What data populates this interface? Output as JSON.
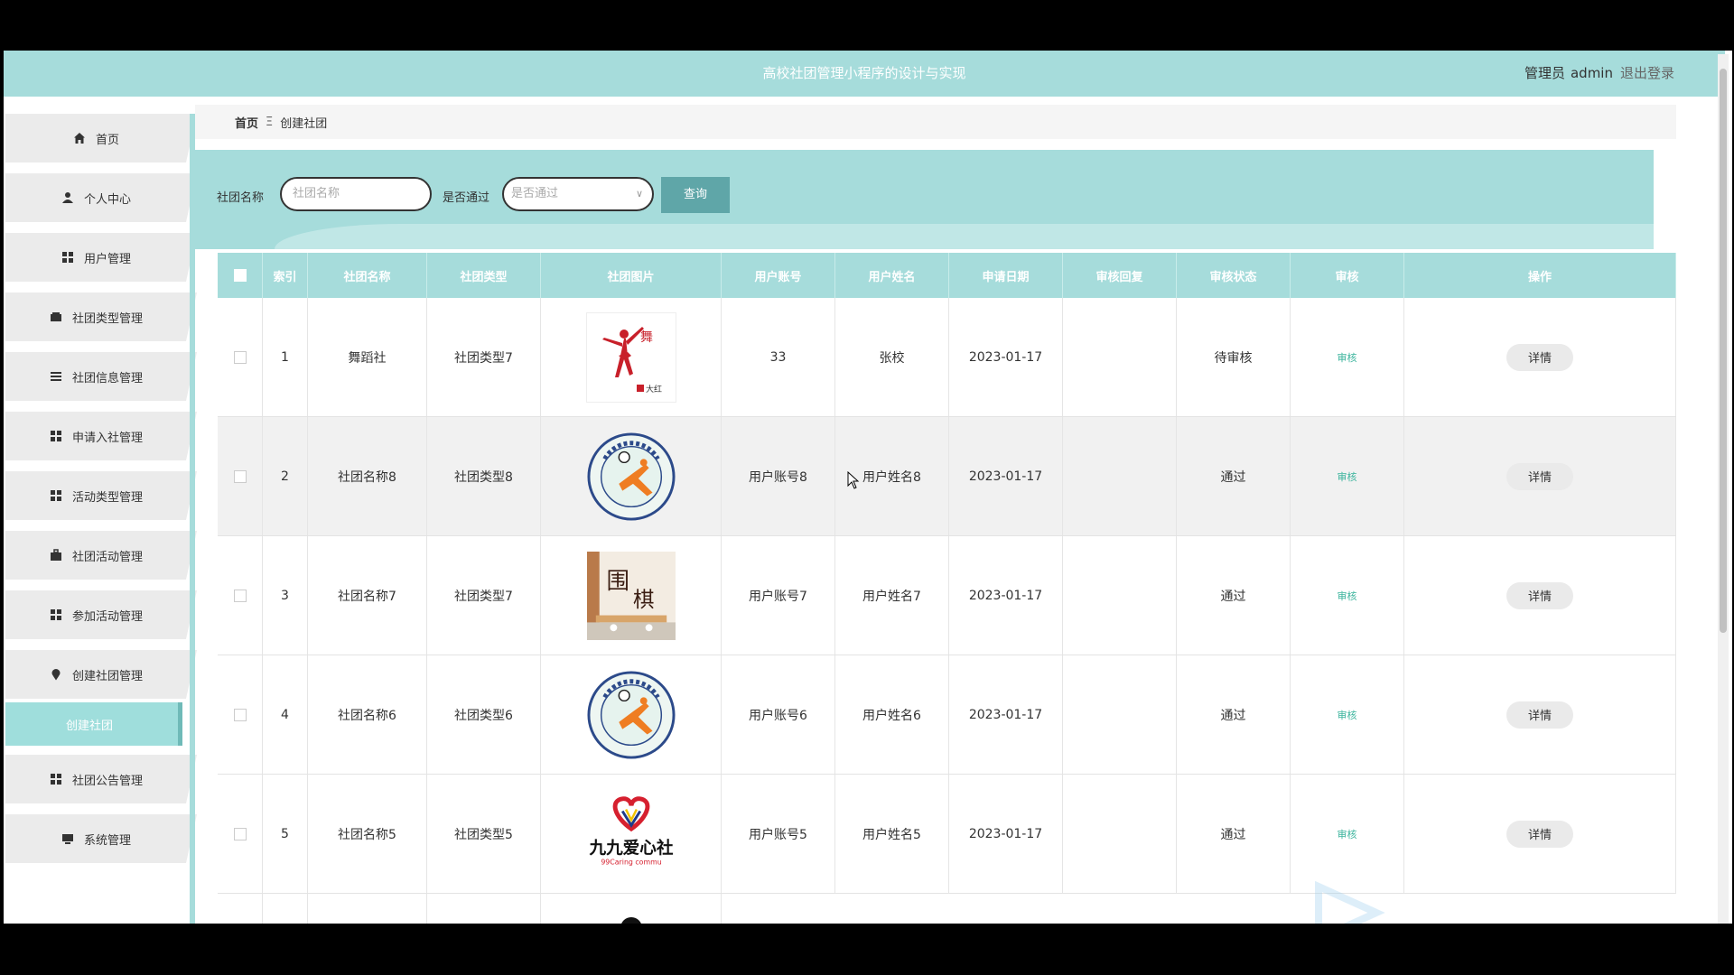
{
  "header": {
    "title": "高校社团管理小程序的设计与实现",
    "role": "管理员",
    "username": "admin",
    "logout": "退出登录"
  },
  "sidebar": {
    "items": [
      {
        "label": "首页",
        "icon": "home-icon"
      },
      {
        "label": "个人中心",
        "icon": "user-icon"
      },
      {
        "label": "用户管理",
        "icon": "grid-icon"
      },
      {
        "label": "社团类型管理",
        "icon": "wallet-icon"
      },
      {
        "label": "社团信息管理",
        "icon": "list-icon"
      },
      {
        "label": "申请入社管理",
        "icon": "grid-icon"
      },
      {
        "label": "活动类型管理",
        "icon": "grid-icon"
      },
      {
        "label": "社团活动管理",
        "icon": "briefcase-icon"
      },
      {
        "label": "参加活动管理",
        "icon": "grid-icon"
      },
      {
        "label": "创建社团管理",
        "icon": "pin-icon"
      },
      {
        "label": "社团公告管理",
        "icon": "grid-icon"
      },
      {
        "label": "系统管理",
        "icon": "monitor-icon"
      }
    ],
    "active_sub": "创建社团"
  },
  "breadcrumb": {
    "home": "首页",
    "separator": "Ξ",
    "current": "创建社团"
  },
  "search": {
    "name_label": "社团名称",
    "name_placeholder": "社团名称",
    "pass_label": "是否通过",
    "pass_placeholder": "是否通过",
    "query_button": "查询"
  },
  "table": {
    "headers": [
      "索引",
      "社团名称",
      "社团类型",
      "社团图片",
      "用户账号",
      "用户姓名",
      "申请日期",
      "审核回复",
      "审核状态",
      "审核",
      "操作"
    ],
    "rows": [
      {
        "index": "1",
        "name": "舞蹈社",
        "type": "社团类型7",
        "image": "dance-logo",
        "account": "33",
        "username": "张校",
        "date": "2023-01-17",
        "reply": "",
        "status": "待审核",
        "audit": "审核",
        "action": "详情"
      },
      {
        "index": "2",
        "name": "社团名称8",
        "type": "社团类型8",
        "image": "football-badge",
        "account": "用户账号8",
        "username": "用户姓名8",
        "date": "2023-01-17",
        "reply": "",
        "status": "通过",
        "audit": "审核",
        "action": "详情"
      },
      {
        "index": "3",
        "name": "社团名称7",
        "type": "社团类型7",
        "image": "go-club-photo",
        "account": "用户账号7",
        "username": "用户姓名7",
        "date": "2023-01-17",
        "reply": "",
        "status": "通过",
        "audit": "审核",
        "action": "详情"
      },
      {
        "index": "4",
        "name": "社团名称6",
        "type": "社团类型6",
        "image": "football-badge",
        "account": "用户账号6",
        "username": "用户姓名6",
        "date": "2023-01-17",
        "reply": "",
        "status": "通过",
        "audit": "审核",
        "action": "详情"
      },
      {
        "index": "5",
        "name": "社团名称5",
        "type": "社团类型5",
        "image": "caring-logo",
        "account": "用户账号5",
        "username": "用户姓名5",
        "date": "2023-01-17",
        "reply": "",
        "status": "通过",
        "audit": "审核",
        "action": "详情"
      }
    ]
  },
  "images": {
    "dance_logo_text": "大红",
    "caring_name": "九九爱心社",
    "caring_sub": "99Caring commu"
  },
  "colors": {
    "accent": "#a6dcdb",
    "button": "#5fa6a8",
    "audit_link": "#3cb49d"
  }
}
